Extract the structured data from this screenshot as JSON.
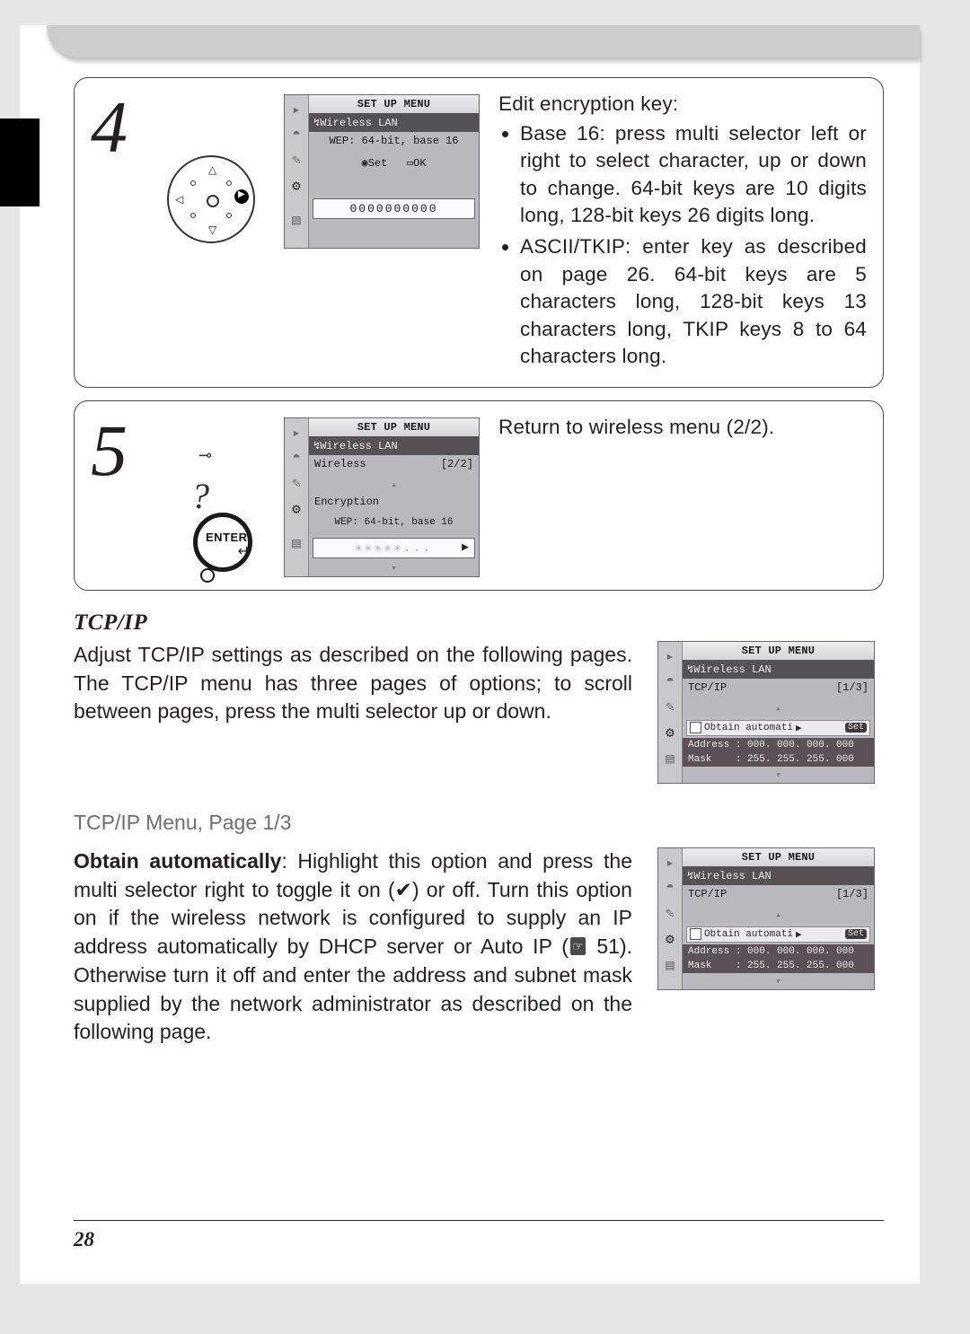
{
  "page_number": "28",
  "steps": {
    "s4": {
      "num": "4",
      "screen": {
        "title": "SET UP MENU",
        "subtitle": "Wireless LAN",
        "line1": "WEP: 64-bit, base 16",
        "set": "Set",
        "ok": "OK",
        "field": "0000000000"
      },
      "desc_lead": "Edit encryption key:",
      "bullet1": "Base 16: press multi selector left or right to select character, up or down to change.  64-bit keys are 10 digits long, 128-bit keys 26 digits long.",
      "bullet2": "ASCII/TKIP: enter key as described on page 26.  64-bit keys are 5 characters long, 128-bit keys 13 characters long, TKIP keys 8 to 64 characters long."
    },
    "s5": {
      "num": "5",
      "enter_label": "ENTER",
      "screen": {
        "title": "SET UP MENU",
        "subtitle": "Wireless LAN",
        "row1": "Wireless",
        "page": "[2/2]",
        "row2": "Encryption",
        "row3": "WEP: 64-bit, base 16",
        "field": "✳✳✳✳✳..."
      },
      "desc": "Return to wireless menu (2/2)."
    }
  },
  "tcpip": {
    "heading": "TCP/IP",
    "para": "Adjust TCP/IP settings as described on the following pages.  The TCP/IP menu has three pages of options; to scroll between pages, press the multi selector up or down.",
    "screenA": {
      "title": "SET UP MENU",
      "subtitle": "Wireless LAN",
      "row1": "TCP/IP",
      "page": "[1/3]",
      "obtain": "Obtain automati",
      "set": "Set",
      "addr_label": "Address",
      "addr_val": ": 000. 000. 000. 000",
      "mask_label": "Mask",
      "mask_val": ": 255. 255. 255. 000"
    },
    "sub": "TCP/IP Menu, Page 1/3",
    "para2a": "Obtain automatically",
    "para2b": ": Highlight this option and press the multi selector right to toggle it on (",
    "check": "✔",
    "para2c": ") or off.  Turn this option on if the wireless network is configured to supply an IP address automatically by DHCP server or Auto IP (",
    "ref": "51",
    "para2d": ").  Otherwise turn it off and enter the address and subnet mask supplied by the network administrator as described on the following page."
  }
}
